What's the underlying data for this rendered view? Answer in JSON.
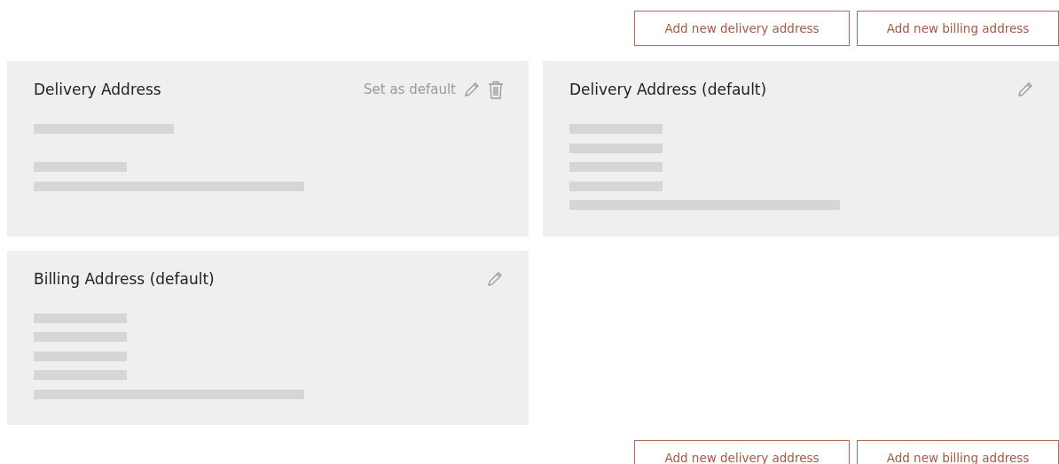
{
  "top_buttons": [
    {
      "label": "Add new delivery address"
    },
    {
      "label": "Add new billing address"
    }
  ],
  "cards": [
    {
      "title": "Delivery Address",
      "actions": [
        {
          "kind": "set-default",
          "label": "Set as default"
        },
        {
          "kind": "edit"
        },
        {
          "kind": "delete"
        }
      ],
      "lines": [
        {
          "kind": "medium"
        },
        {
          "kind": "gap"
        },
        {
          "kind": "short"
        },
        {
          "kind": "long"
        }
      ]
    },
    {
      "title": "Delivery Address (default)",
      "actions": [
        {
          "kind": "edit"
        }
      ],
      "lines": [
        {
          "kind": "short"
        },
        {
          "kind": "short"
        },
        {
          "kind": "short"
        },
        {
          "kind": "short"
        },
        {
          "kind": "long"
        }
      ]
    },
    {
      "title": "Billing Address (default)",
      "actions": [
        {
          "kind": "edit"
        }
      ],
      "lines": [
        {
          "kind": "short"
        },
        {
          "kind": "short"
        },
        {
          "kind": "short"
        },
        {
          "kind": "short"
        },
        {
          "kind": "long"
        }
      ]
    }
  ],
  "bottom_buttons": [
    {
      "label": "Add new delivery address"
    },
    {
      "label": "Add new billing address"
    }
  ]
}
